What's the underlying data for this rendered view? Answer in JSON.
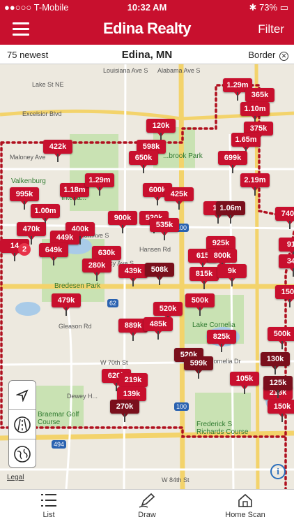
{
  "status": {
    "carrier": "●●○○○ T-Mobile",
    "time": "10:32 AM",
    "battery": "73%"
  },
  "header": {
    "brand": "Edina Realty",
    "filter_label": "Filter"
  },
  "subbar": {
    "newest": "75 newest",
    "location": "Edina, MN",
    "border_label": "Border",
    "clear_icon": "close-icon"
  },
  "map": {
    "labels": [
      "Lake St NE",
      "Excelsior Blvd",
      "Maloney Ave",
      "Valkenburg",
      "Interla...",
      "Vernon Ave S",
      "Bredesen Park",
      "Gleason Rd",
      "W 70th St",
      "Dewey H...",
      "Braemar Golf Course",
      "Lake Cornelia",
      "Frederick S Richards Course",
      "W 84th St",
      "Louisiana Ave S",
      "Alabama Ave S",
      "Hansen Rd",
      "Tracy Ave S",
      "Cornelia Dr",
      "...brook Park",
      "Legal"
    ],
    "highway_shields": [
      "100",
      "62",
      "100",
      "494"
    ],
    "pins": [
      {
        "price": "1.29m"
      },
      {
        "price": "365k"
      },
      {
        "price": "1.10m"
      },
      {
        "price": "375k"
      },
      {
        "price": "1.65m"
      },
      {
        "price": "120k"
      },
      {
        "price": "598k"
      },
      {
        "price": "650k"
      },
      {
        "price": "422k"
      },
      {
        "price": "699k"
      },
      {
        "price": "995k"
      },
      {
        "price": "1.18m"
      },
      {
        "price": "1.29m"
      },
      {
        "price": "600k"
      },
      {
        "price": "425k"
      },
      {
        "price": "2.19m"
      },
      {
        "price": "1.00m"
      },
      {
        "price": "1.0"
      },
      {
        "price": "1.06m"
      },
      {
        "price": "740k"
      },
      {
        "price": "900k"
      },
      {
        "price": "520k"
      },
      {
        "price": "535k"
      },
      {
        "price": "470k"
      },
      {
        "price": "400k"
      },
      {
        "price": "449k"
      },
      {
        "price": "925k"
      },
      {
        "price": "910"
      },
      {
        "price": "14"
      },
      {
        "price": "649k"
      },
      {
        "price": "630k"
      },
      {
        "price": "280k"
      },
      {
        "price": "439k"
      },
      {
        "price": "508k"
      },
      {
        "price": "615"
      },
      {
        "price": "800k"
      },
      {
        "price": "815k"
      },
      {
        "price": "9k"
      },
      {
        "price": "340"
      },
      {
        "price": "150k"
      },
      {
        "price": "479k"
      },
      {
        "price": "520k"
      },
      {
        "price": "500k"
      },
      {
        "price": "889k"
      },
      {
        "price": "485k"
      },
      {
        "price": "825k"
      },
      {
        "price": "500k"
      },
      {
        "price": "520k"
      },
      {
        "price": "599k"
      },
      {
        "price": "130k"
      },
      {
        "price": "105k"
      },
      {
        "price": "620k"
      },
      {
        "price": "219k"
      },
      {
        "price": "139k"
      },
      {
        "price": "270k"
      },
      {
        "price": "218k"
      },
      {
        "price": "150k"
      },
      {
        "price": "125k"
      }
    ],
    "cluster_badge": "2",
    "info_label": "i",
    "legal_label": "Legal"
  },
  "tools": [
    {
      "icon": "location-arrow-icon"
    },
    {
      "icon": "road-icon"
    },
    {
      "icon": "globe-icon"
    }
  ],
  "tabs": [
    {
      "label": "List",
      "icon": "list-icon"
    },
    {
      "label": "Draw",
      "icon": "pencil-icon"
    },
    {
      "label": "Home Scan",
      "icon": "home-scan-icon"
    }
  ],
  "colors": {
    "brand": "#c8102e",
    "dark_pin": "#7a0f1c"
  }
}
